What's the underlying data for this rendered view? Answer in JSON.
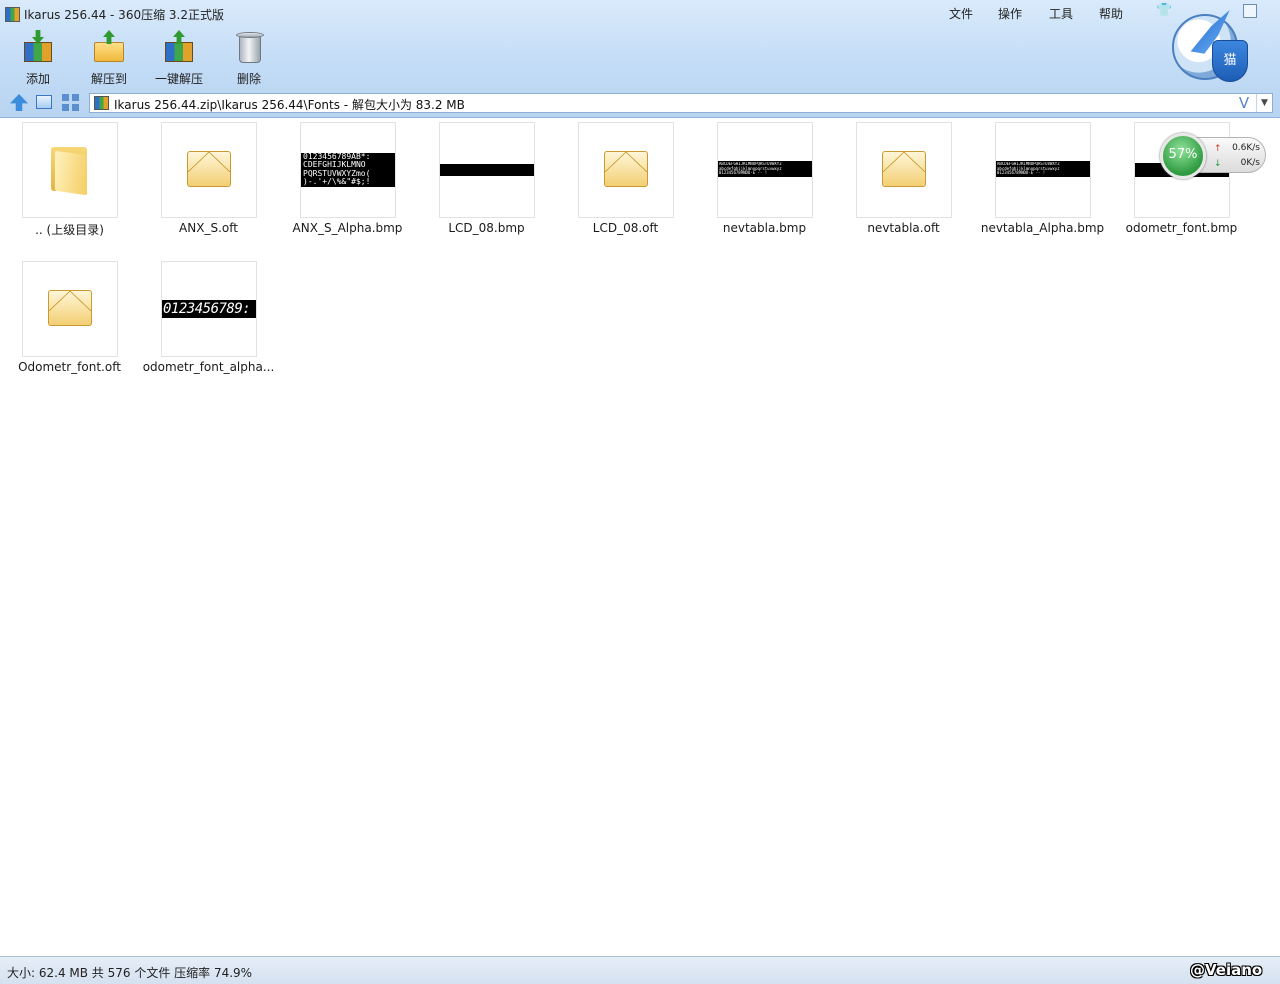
{
  "window": {
    "title": "Ikarus 256.44 - 360压缩 3.2正式版",
    "menu": [
      "文件",
      "操作",
      "工具",
      "帮助"
    ],
    "mascot_label": "猫"
  },
  "toolbar": {
    "add": "添加",
    "extract_to": "解压到",
    "one_click_extract": "一键解压",
    "delete": "删除"
  },
  "address": {
    "path": "Ikarus 256.44.zip\\Ikarus 256.44\\Fonts - 解包大小为 83.2 MB",
    "v_glyph": "V",
    "dropdown_glyph": "▼"
  },
  "files": [
    {
      "name": ".. (上级目录)",
      "kind": "folder"
    },
    {
      "name": "ANX_S.oft",
      "kind": "oft"
    },
    {
      "name": "ANX_S_Alpha.bmp",
      "kind": "bmp"
    },
    {
      "name": "LCD_08.bmp",
      "kind": "bmp"
    },
    {
      "name": "LCD_08.oft",
      "kind": "oft"
    },
    {
      "name": "nevtabla.bmp",
      "kind": "bmp"
    },
    {
      "name": "nevtabla.oft",
      "kind": "oft"
    },
    {
      "name": "nevtabla_Alpha.bmp",
      "kind": "bmp"
    },
    {
      "name": "odometr_font.bmp",
      "kind": "bmp"
    },
    {
      "name": "Odometr_font.oft",
      "kind": "oft"
    },
    {
      "name": "odometr_font_alpha...",
      "kind": "bmp"
    }
  ],
  "thumb_text": {
    "anx_lines": "0123456789AB*:\nCDEFGHIJKLMNO\nPQRSTUVWXYZmo(\n)-.'+/\\%&\"#$;!",
    "nev_lines": "ABCDEFGHIJKLMNOPQRSTUVWXYZ\nabcdefghijklmnopqrstuvwxyz\n0123456789NDO-E -- !",
    "nevA_lines": "ABCDEFGHIJKLMNOPQRSTUVWXYZ\nabcdefghijklmnopqrstuvwxyz\n0123456789NDO-E -- !",
    "odo_digits": "0123456789:"
  },
  "gauge": {
    "percent": "57%",
    "up_speed": "0.6K/s",
    "down_speed": "0K/s",
    "up_arrow": "↑",
    "down_arrow": "↓"
  },
  "status": {
    "text": "大小: 62.4 MB 共 576 个文件 压缩率 74.9%",
    "watermark": "@Veiano"
  },
  "colors": {
    "chrome": "#c3dcf6",
    "gauge_green": "#2f9a3f"
  }
}
